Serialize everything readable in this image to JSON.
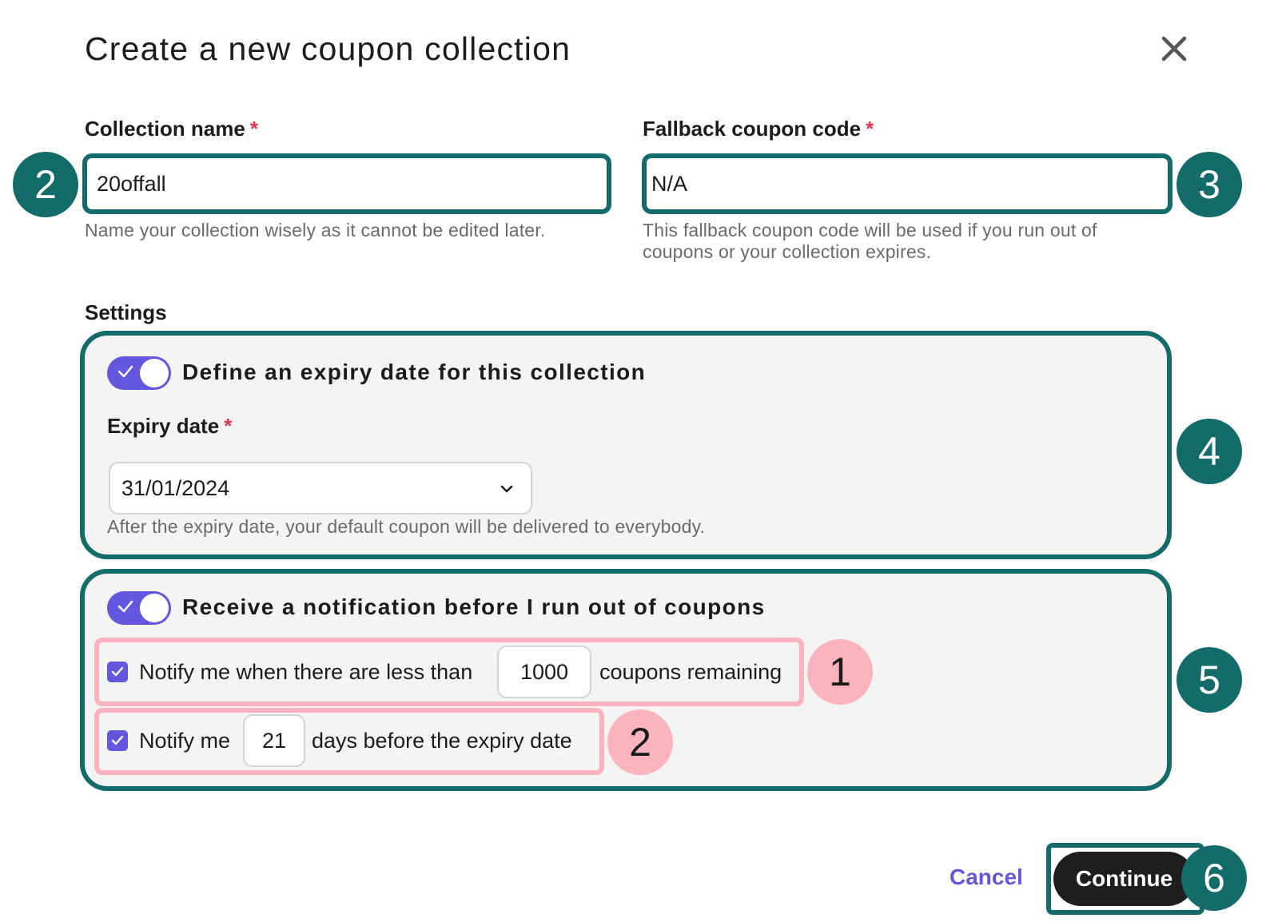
{
  "dialog": {
    "title": "Create a new coupon collection",
    "close_icon": "close-icon"
  },
  "collection_name": {
    "label": "Collection name",
    "required_marker": "*",
    "value": "20offall",
    "help": "Name your collection wisely as it cannot be edited later."
  },
  "fallback_code": {
    "label": "Fallback coupon code",
    "required_marker": "*",
    "value": "N/A",
    "help": "This fallback coupon code will be used if you run out of coupons or your collection expires."
  },
  "settings": {
    "label": "Settings",
    "expiry": {
      "toggle_on": true,
      "toggle_label": "Define an expiry date for this collection",
      "date_label": "Expiry date",
      "required_marker": "*",
      "date_value": "31/01/2024",
      "help": "After the expiry date, your default coupon will be delivered to everybody."
    },
    "notification": {
      "toggle_on": true,
      "toggle_label": "Receive a notification before I run out of coupons",
      "remaining": {
        "checked": true,
        "prefix": "Notify me when there are less than",
        "value": "1000",
        "suffix": "coupons remaining"
      },
      "days_before": {
        "checked": true,
        "prefix": "Notify me",
        "value": "21",
        "suffix": "days before the expiry date"
      }
    }
  },
  "footer": {
    "cancel_label": "Cancel",
    "continue_label": "Continue"
  },
  "annotations": {
    "teal": [
      "2",
      "3",
      "4",
      "5",
      "6"
    ],
    "pink": [
      "1",
      "2"
    ]
  },
  "colors": {
    "accent_teal": "#136b6a",
    "accent_purple": "#6457de",
    "annotation_pink": "#fbb3bd",
    "required_red": "#e8334a"
  }
}
